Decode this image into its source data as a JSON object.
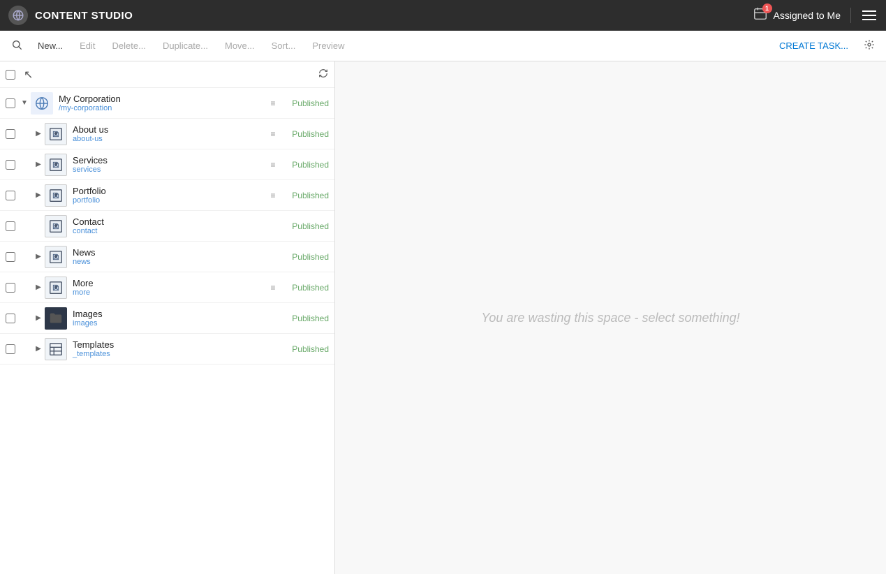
{
  "app": {
    "title": "CONTENT STUDIO"
  },
  "topbar": {
    "assigned_label": "Assigned to Me",
    "assigned_count": "1"
  },
  "toolbar": {
    "search_label": "",
    "new_label": "New...",
    "edit_label": "Edit",
    "delete_label": "Delete...",
    "duplicate_label": "Duplicate...",
    "move_label": "Move...",
    "sort_label": "Sort...",
    "preview_label": "Preview",
    "create_task_label": "CREATE TASK..."
  },
  "tree": {
    "refresh_icon": "↺",
    "items": [
      {
        "id": "my-corporation",
        "name": "My Corporation",
        "path": "/my-corporation",
        "icon_type": "globe",
        "expanded": true,
        "has_children": true,
        "has_drag": true,
        "status": "Published",
        "indent": 0
      },
      {
        "id": "about-us",
        "name": "About us",
        "path": "about-us",
        "icon_type": "page",
        "expanded": false,
        "has_children": true,
        "has_drag": true,
        "status": "Published",
        "indent": 1
      },
      {
        "id": "services",
        "name": "Services",
        "path": "services",
        "icon_type": "page",
        "expanded": false,
        "has_children": true,
        "has_drag": true,
        "status": "Published",
        "indent": 1
      },
      {
        "id": "portfolio",
        "name": "Portfolio",
        "path": "portfolio",
        "icon_type": "page",
        "expanded": false,
        "has_children": true,
        "has_drag": true,
        "status": "Published",
        "indent": 1
      },
      {
        "id": "contact",
        "name": "Contact",
        "path": "contact",
        "icon_type": "page",
        "expanded": false,
        "has_children": false,
        "has_drag": false,
        "status": "Published",
        "indent": 1
      },
      {
        "id": "news",
        "name": "News",
        "path": "news",
        "icon_type": "page",
        "expanded": false,
        "has_children": true,
        "has_drag": false,
        "status": "Published",
        "indent": 1
      },
      {
        "id": "more",
        "name": "More",
        "path": "more",
        "icon_type": "page",
        "expanded": false,
        "has_children": true,
        "has_drag": true,
        "status": "Published",
        "indent": 1
      },
      {
        "id": "images",
        "name": "Images",
        "path": "images",
        "icon_type": "folder",
        "expanded": false,
        "has_children": true,
        "has_drag": false,
        "status": "Published",
        "indent": 1
      },
      {
        "id": "templates",
        "name": "Templates",
        "path": "_templates",
        "icon_type": "template",
        "expanded": false,
        "has_children": true,
        "has_drag": false,
        "status": "Published",
        "indent": 1
      }
    ]
  },
  "right_panel": {
    "empty_message": "You are wasting this space - select something!"
  }
}
